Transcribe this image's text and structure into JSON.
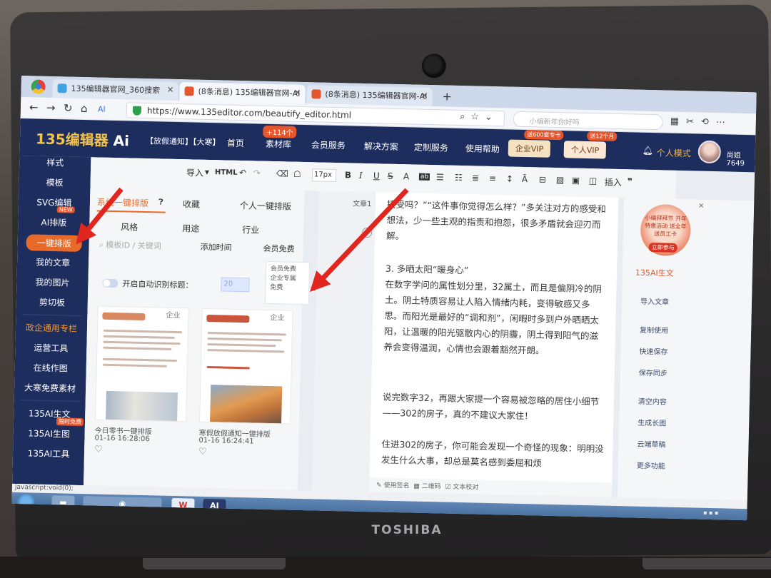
{
  "browser": {
    "tabs": [
      {
        "title": "135编辑器官网_360搜索"
      },
      {
        "title": "(8条消息) 135编辑器官网-AI"
      },
      {
        "title": "(8条消息) 135编辑器官网-AI"
      }
    ],
    "url": "https://www.135editor.com/beautify_editor.html",
    "search_placeholder": "小编新年你好吗"
  },
  "header": {
    "logo": "135编辑器",
    "logo_ai": "Ai",
    "notice": "【放假通知】【大寒】",
    "nav": [
      "首页",
      "素材库",
      "会员服务",
      "解决方案",
      "定制服务",
      "使用帮助"
    ],
    "material_badge": "+114个",
    "enterprise_vip": "企业VIP",
    "enterprise_vip_tag": "送600套专卡",
    "personal_vip": "个人VIP",
    "personal_vip_tag": "送12个月",
    "mode": "个人模式",
    "username": "尚姐7649"
  },
  "sidebar": {
    "items": [
      "样式",
      "模板",
      "SVG编辑",
      "AI排版",
      "一键排版",
      "我的文章",
      "我的图片",
      "剪切板"
    ],
    "new_tag": "NEW",
    "section_title": "政企通用专栏",
    "tools": [
      "运营工具",
      "在线作图",
      "大寒免费素材"
    ],
    "ai_items": [
      "135AI生文",
      "135AI生图",
      "135AI工具"
    ],
    "free_tag": "限时免费"
  },
  "panel": {
    "tabs": [
      "系统一键排版",
      "收藏",
      "个人一键排版"
    ],
    "filters": [
      "风格",
      "用途",
      "行业"
    ],
    "search_placeholder": "模板ID / 关键词",
    "sort": "添加时间",
    "member_filter": "会员免费",
    "dropdown_options": [
      "会员免费",
      "企业专属",
      "免费"
    ],
    "auto_title_label": "开启自动识别标题：",
    "auto_title_value": "20",
    "cards": [
      {
        "tag": "企业",
        "title": "今日零书一键排版",
        "time": "01-16 16:28:06"
      },
      {
        "tag": "企业",
        "title": "寒假放假通知一键排版",
        "time": "01-16 16:24:41"
      }
    ]
  },
  "toolbar": {
    "import": "导入",
    "html": "HTML",
    "font_size": "17px",
    "insert": "插入"
  },
  "editor": {
    "label": "文章1",
    "paragraphs": [
      "接受吗？”“这件事你觉得怎么样？”多关注对方的感受和想法，少一些主观的指责和抱怨，很多矛盾就会迎刃而解。",
      "3. 多晒太阳“暖身心”",
      "在数字学问的属性划分里，32属土，而且是偏阴冷的阴土。阴土特质容易让人陷入情绪内耗，变得敏感又多思。而阳光是最好的“调和剂”，闲暇时多到户外晒晒太阳，让温暖的阳光驱散内心的阴霾，阴土得到阳气的滋养会变得温润，心情也会跟着豁然开朗。",
      "说完数字32，再跟大家提一个容易被忽略的居住小细节——302的房子，真的不建议大家住！",
      "住进302的房子，你可能会发现一个奇怪的现象：明明没发生什么大事，却总是莫名感到委屈和烦"
    ],
    "footer": [
      "使用签名",
      "二维码",
      "文本校对"
    ]
  },
  "right_panel": {
    "promo_text": "小编拜拜节 开年特惠活动 送全年 送员工卡",
    "promo_button": "立即参与",
    "ai_link": "135AI生文",
    "items": [
      "导入文章",
      "复制使用",
      "快速保存",
      "保存同步",
      "清空内容",
      "生成长图",
      "云端草稿",
      "更多功能"
    ]
  },
  "status_text": "javascript:void(0);",
  "laptop_brand": "TOSHIBA",
  "colors": {
    "nav_bg": "#1d2d5e",
    "accent": "#e86a2a",
    "arrow": "#e0261f"
  }
}
